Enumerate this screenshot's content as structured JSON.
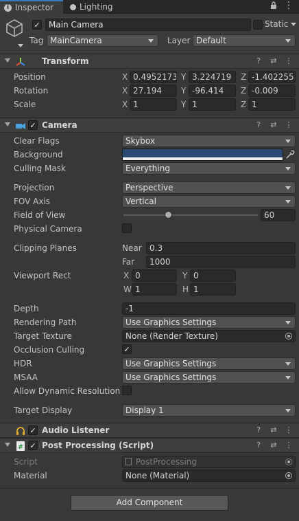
{
  "tabs": {
    "inspector": "Inspector",
    "lighting": "Lighting"
  },
  "gameobject": {
    "active": true,
    "name": "Main Camera",
    "static_label": "Static",
    "static": false,
    "tag_label": "Tag",
    "tag_value": "MainCamera",
    "layer_label": "Layer",
    "layer_value": "Default"
  },
  "transform": {
    "title": "Transform",
    "position_label": "Position",
    "rotation_label": "Rotation",
    "scale_label": "Scale",
    "axis_x": "X",
    "axis_y": "Y",
    "axis_z": "Z",
    "position": {
      "x": "0.4952173",
      "y": "3.224719",
      "z": "-1.402255"
    },
    "rotation": {
      "x": "27.194",
      "y": "-96.414",
      "z": "-0.009"
    },
    "scale": {
      "x": "1",
      "y": "1",
      "z": "1"
    }
  },
  "camera": {
    "title": "Camera",
    "enabled": true,
    "clear_flags_label": "Clear Flags",
    "clear_flags": "Skybox",
    "background_label": "Background",
    "background_color": "#2c4a73",
    "culling_mask_label": "Culling Mask",
    "culling_mask": "Everything",
    "projection_label": "Projection",
    "projection": "Perspective",
    "fov_axis_label": "FOV Axis",
    "fov_axis": "Vertical",
    "fov_label": "Field of View",
    "fov_value": "60",
    "physical_camera_label": "Physical Camera",
    "physical_camera": false,
    "clipping_planes_label": "Clipping Planes",
    "near_label": "Near",
    "near_value": "0.3",
    "far_label": "Far",
    "far_value": "1000",
    "viewport_rect_label": "Viewport Rect",
    "vp_x_label": "X",
    "vp_y_label": "Y",
    "vp_w_label": "W",
    "vp_h_label": "H",
    "vp_x": "0",
    "vp_y": "0",
    "vp_w": "1",
    "vp_h": "1",
    "depth_label": "Depth",
    "depth_value": "-1",
    "rendering_path_label": "Rendering Path",
    "rendering_path": "Use Graphics Settings",
    "target_texture_label": "Target Texture",
    "target_texture": "None (Render Texture)",
    "occlusion_culling_label": "Occlusion Culling",
    "occlusion_culling": true,
    "hdr_label": "HDR",
    "hdr": "Use Graphics Settings",
    "msaa_label": "MSAA",
    "msaa": "Use Graphics Settings",
    "dynamic_resolution_label": "Allow Dynamic Resolution",
    "dynamic_resolution": false,
    "target_display_label": "Target Display",
    "target_display": "Display 1"
  },
  "audio_listener": {
    "title": "Audio Listener",
    "enabled": true
  },
  "post_processing": {
    "title": "Post Processing (Script)",
    "enabled": true,
    "script_label": "Script",
    "script_value": "PostProcessing",
    "material_label": "Material",
    "material_value": "None (Material)"
  },
  "add_component_label": "Add Component",
  "check_glyph": "✓"
}
